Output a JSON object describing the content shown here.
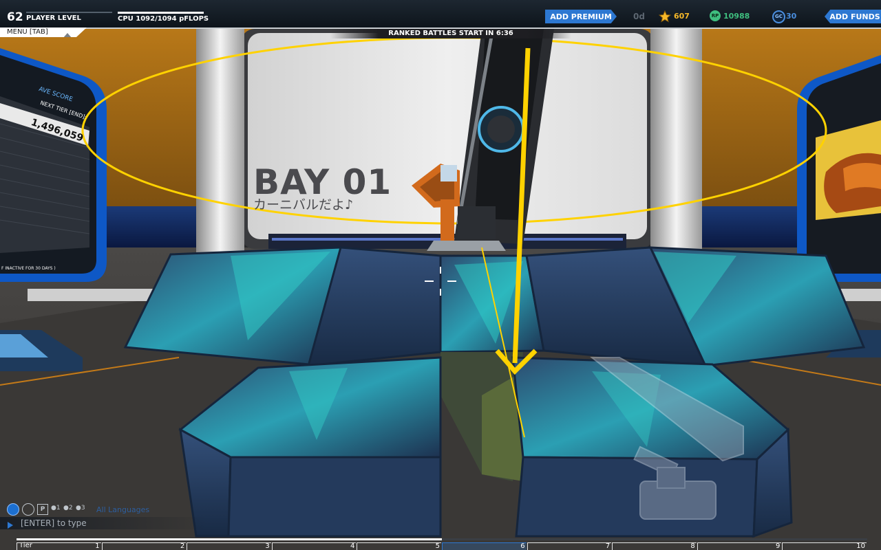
{
  "hud": {
    "player_level_number": "62",
    "player_level_label": "PLAYER LEVEL",
    "cpu_label": "CPU 1092/1094 pFLOPS",
    "cpu_fill": 0.998,
    "menu_label": "MENU [TAB]",
    "add_premium_label": "ADD PREMIUM",
    "premium_days": "0d",
    "robit_count": "607",
    "rp_count": "10988",
    "gc_count": "30",
    "add_funds_label": "ADD FUNDS",
    "ranked_banner": "RANKED BATTLES START IN 6:36"
  },
  "bay": {
    "title": "BAY 01",
    "subtitle": "カーニバルだよ♪"
  },
  "left_screen": {
    "ave_score": "AVE SCORE",
    "next_tier": "NEXT TIER [END]:",
    "score": "1,496,059",
    "inactive": "F INACTIVE FOR 30 DAYS )"
  },
  "chat": {
    "language": "All Languages",
    "input_placeholder": "[ENTER] to type"
  },
  "tier_bar": {
    "label": "Tier",
    "numbers": [
      "1",
      "2",
      "3",
      "4",
      "5",
      "6",
      "7",
      "8",
      "9",
      "10"
    ],
    "active_index": 5,
    "progress_fraction": 0.5
  },
  "colors": {
    "accent_blue": "#2d78d2",
    "guide_yellow": "#ffd200",
    "rp_green": "#3fbf7f",
    "gold": "#f6b829"
  },
  "icons": {
    "robit": "star-icon",
    "rp": "rp-icon",
    "gc": "gc-icon",
    "chat_global": "globe-icon",
    "chat_tabs": [
      "globe-icon",
      "accessibility-icon",
      "party-icon",
      "user-1-icon",
      "user-2-icon",
      "user-3-icon"
    ]
  }
}
